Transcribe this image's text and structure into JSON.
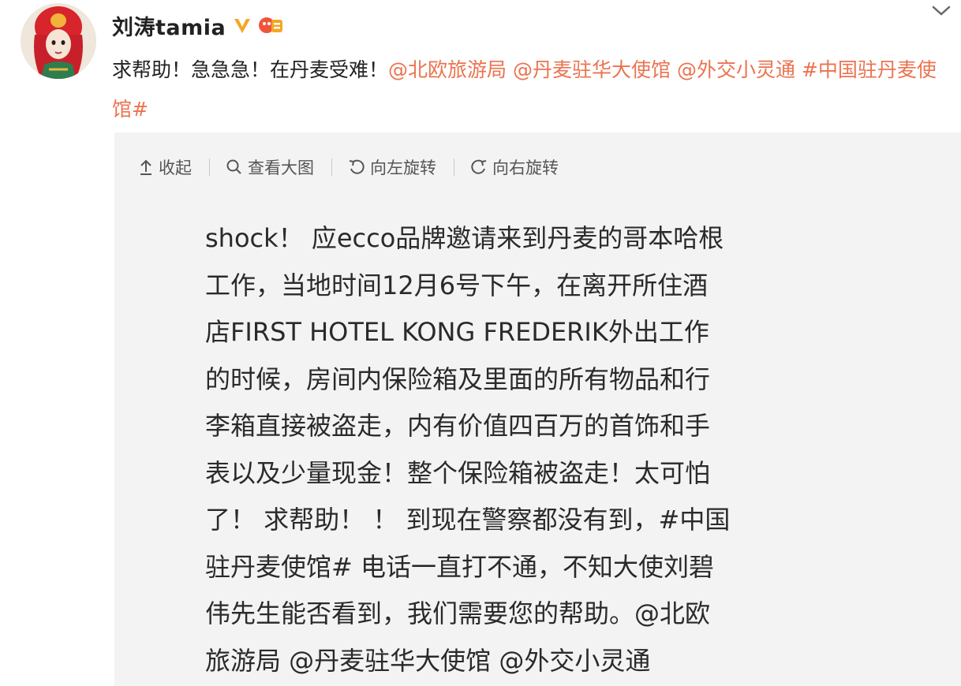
{
  "post": {
    "username": "刘涛tamia",
    "avatar_icon": "avatar-illustration",
    "text_lead": "求帮助！急急急！在丹麦受难！",
    "mentions": [
      "@北欧旅游局",
      "@丹麦驻华大使馆",
      "@外交小灵通"
    ],
    "hashtag": "#中国驻丹麦使馆#",
    "accent_color": "#eb7350",
    "verified_color": "#f5a623"
  },
  "media_toolbar": {
    "collapse": "收起",
    "view_large": "查看大图",
    "rotate_left": "向左旋转",
    "rotate_right": "向右旋转"
  },
  "image_text": {
    "lines": [
      "shock！ 应ecco品牌邀请来到丹麦的哥本哈根",
      "工作，当地时间12月6号下午，在离开所住酒",
      "店FIRST HOTEL KONG FREDERIK外出工作",
      "的时候，房间内保险箱及里面的所有物品和行",
      "李箱直接被盗走，内有价值四百万的首饰和手",
      "表以及少量现金！整个保险箱被盗走！太可怕",
      "了！ 求帮助！ ！ 到现在警察都没有到，#中国",
      "驻丹麦使馆# 电话一直打不通，不知大使刘碧",
      "伟先生能否看到，我们需要您的帮助。@北欧",
      "旅游局 @丹麦驻华大使馆 @外交小灵通"
    ]
  }
}
